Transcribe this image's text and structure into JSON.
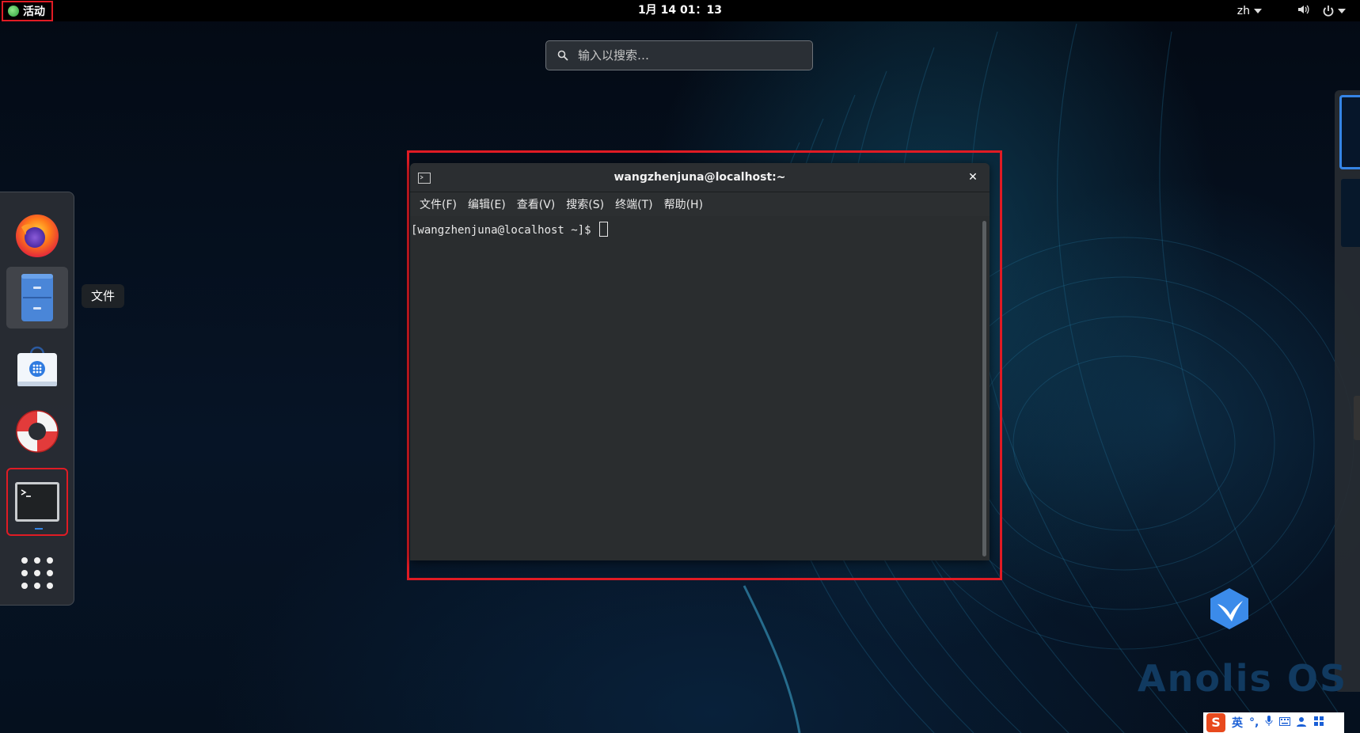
{
  "topbar": {
    "activities_label": "活动",
    "clock": "1月 14  01：13",
    "language": "zh",
    "volume_icon": "volume-icon",
    "power_icon": "power-icon"
  },
  "search": {
    "placeholder": "输入以搜索…"
  },
  "dash": {
    "items": [
      {
        "name": "firefox",
        "icon": "firefox-icon"
      },
      {
        "name": "files",
        "icon": "file-cabinet-icon"
      },
      {
        "name": "software",
        "icon": "software-bag-icon"
      },
      {
        "name": "help",
        "icon": "lifebuoy-icon"
      },
      {
        "name": "terminal",
        "icon": "terminal-icon"
      },
      {
        "name": "show-apps",
        "icon": "app-grid-icon"
      }
    ],
    "tooltip": "文件"
  },
  "terminal_window": {
    "title": "wangzhenjuna@localhost:~",
    "menu": [
      "文件(F)",
      "编辑(E)",
      "查看(V)",
      "搜索(S)",
      "终端(T)",
      "帮助(H)"
    ],
    "prompt": "[wangzhenjuna@localhost ~]$ "
  },
  "branding": {
    "os_name": "Anolis OS"
  },
  "ime": {
    "logo": "S",
    "mode": "英"
  },
  "colors": {
    "highlight": "#e01b24",
    "accent": "#3584e4",
    "topbar": "#000000",
    "terminal_bg": "#2a2d2f"
  }
}
